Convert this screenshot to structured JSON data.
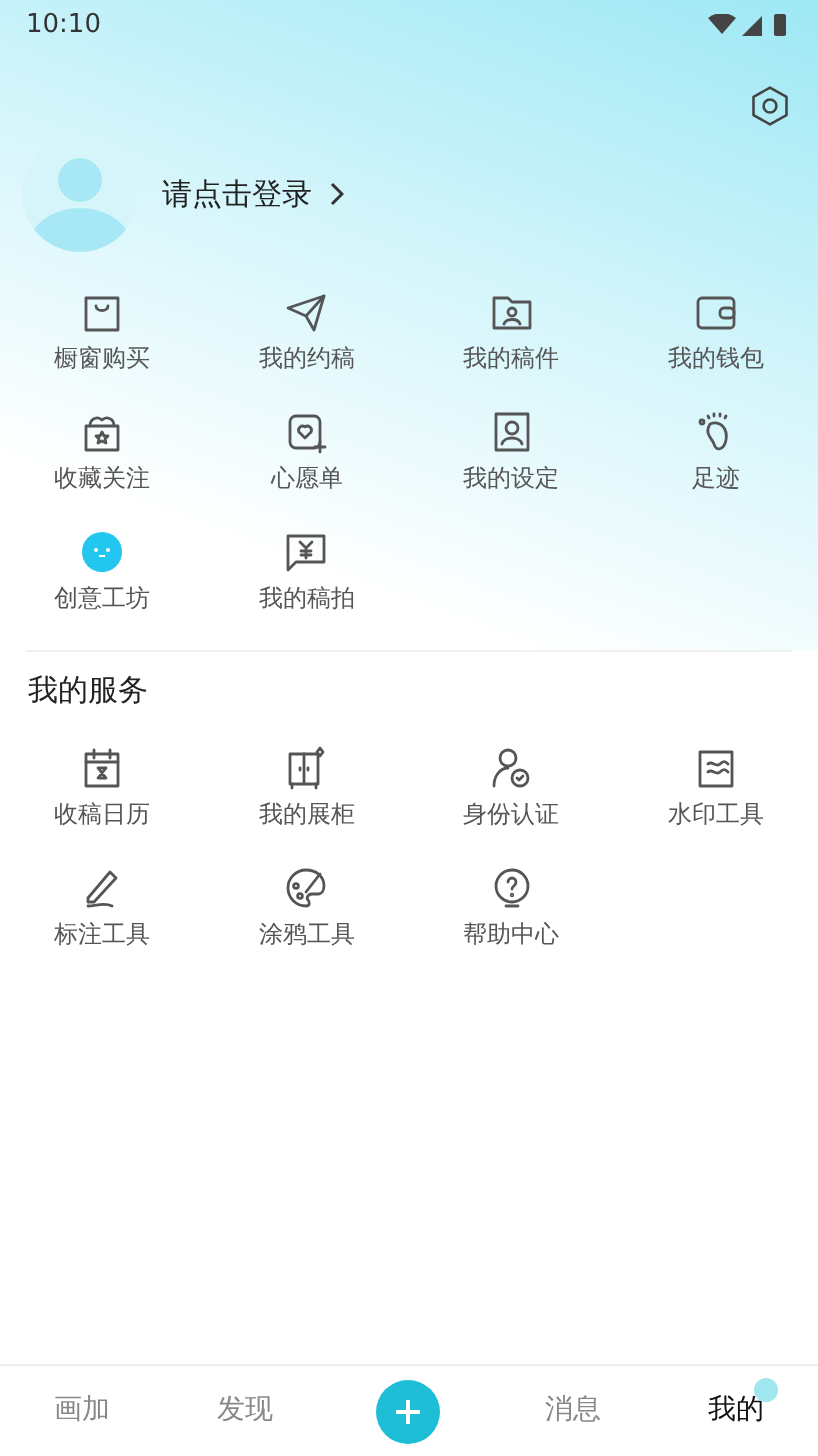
{
  "status_bar": {
    "time": "10:10"
  },
  "profile": {
    "login_prompt": "请点击登录"
  },
  "shortcuts": [
    {
      "label": "橱窗购买"
    },
    {
      "label": "我的约稿"
    },
    {
      "label": "我的稿件"
    },
    {
      "label": "我的钱包"
    },
    {
      "label": "收藏关注"
    },
    {
      "label": "心愿单"
    },
    {
      "label": "我的设定"
    },
    {
      "label": "足迹"
    },
    {
      "label": "创意工坊"
    },
    {
      "label": "我的稿拍"
    }
  ],
  "services": {
    "title": "我的服务",
    "items": [
      {
        "label": "收稿日历"
      },
      {
        "label": "我的展柜"
      },
      {
        "label": "身份认证"
      },
      {
        "label": "水印工具"
      },
      {
        "label": "标注工具"
      },
      {
        "label": "涂鸦工具"
      },
      {
        "label": "帮助中心"
      }
    ]
  },
  "tab_bar": [
    {
      "kind": "tab",
      "label": "画加",
      "selected": false
    },
    {
      "kind": "tab",
      "label": "发现",
      "selected": false
    },
    {
      "kind": "add"
    },
    {
      "kind": "tab",
      "label": "消息",
      "selected": false
    },
    {
      "kind": "tab",
      "label": "我的",
      "selected": true
    }
  ]
}
